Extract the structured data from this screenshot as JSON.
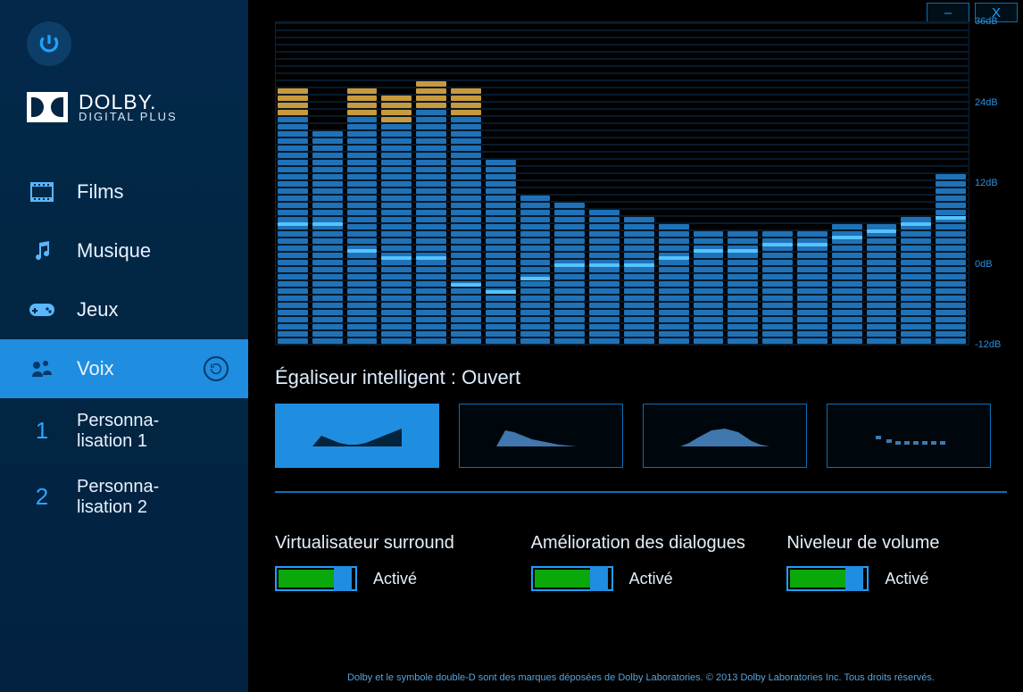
{
  "window": {
    "minimize_glyph": "–",
    "close_glyph": "X"
  },
  "brand": {
    "name": "DOLBY.",
    "sub": "DIGITAL PLUS"
  },
  "nav": {
    "films": "Films",
    "musique": "Musique",
    "jeux": "Jeux",
    "voix": "Voix",
    "custom1_num": "1",
    "custom1_label": "Personna-\nlisation 1",
    "custom2_num": "2",
    "custom2_label": "Personna-\nlisation 2"
  },
  "eq": {
    "title": "Égaliseur intelligent : Ouvert",
    "axis_labels": [
      "36dB",
      "24dB",
      "12dB",
      "0dB",
      "-12dB"
    ],
    "axis_values_db": [
      36,
      24,
      12,
      0,
      -12
    ]
  },
  "presets": {
    "active_index": 0,
    "names": [
      "open",
      "warm",
      "bright",
      "flat"
    ]
  },
  "toggles": {
    "surround": {
      "title": "Virtualisateur surround",
      "state": "Activé",
      "on": true
    },
    "dialog": {
      "title": "Amélioration des dialogues",
      "state": "Activé",
      "on": true
    },
    "volume": {
      "title": "Niveleur de volume",
      "state": "Activé",
      "on": true
    }
  },
  "footer": "Dolby et le symbole double-D sont des marques déposées de Dolby Laboratories. © 2013 Dolby Laboratories Inc. Tous droits réservés.",
  "chart_data": {
    "type": "bar",
    "title": "Égaliseur intelligent : Ouvert",
    "ylabel": "dB",
    "ylim": [
      -12,
      36
    ],
    "categories": [
      "b1",
      "b2",
      "b3",
      "b4",
      "b5",
      "b6",
      "b7",
      "b8",
      "b9",
      "b10",
      "b11",
      "b12",
      "b13",
      "b14",
      "b15",
      "b16",
      "b17",
      "b18",
      "b19",
      "b20"
    ],
    "series": [
      {
        "name": "bars_bottom_db",
        "values": [
          -12,
          -12,
          -12,
          -12,
          -12,
          -12,
          -12,
          -12,
          -12,
          -12,
          -12,
          -12,
          -12,
          -12,
          -12,
          -12,
          -12,
          -12,
          -12,
          -12
        ]
      },
      {
        "name": "bars_top_db",
        "values": [
          22,
          20,
          22,
          21,
          23,
          22,
          16,
          10,
          9,
          8,
          7,
          6,
          5,
          5,
          5,
          5,
          6,
          6,
          7,
          13
        ]
      },
      {
        "name": "peak_cap_db",
        "values": [
          24,
          22,
          24,
          23,
          25,
          24,
          16,
          10,
          9,
          8,
          7,
          6,
          5,
          5,
          5,
          5,
          6,
          6,
          7,
          13
        ]
      },
      {
        "name": "peak_cap_gold",
        "values": [
          1,
          0,
          1,
          1,
          1,
          1,
          0,
          0,
          0,
          0,
          0,
          0,
          0,
          0,
          0,
          0,
          0,
          0,
          0,
          0
        ]
      },
      {
        "name": "marker_db",
        "values": [
          6,
          6,
          2,
          1,
          1,
          -3,
          -4,
          -2,
          0,
          0,
          0,
          1,
          2,
          2,
          3,
          3,
          4,
          5,
          6,
          7
        ]
      }
    ]
  }
}
